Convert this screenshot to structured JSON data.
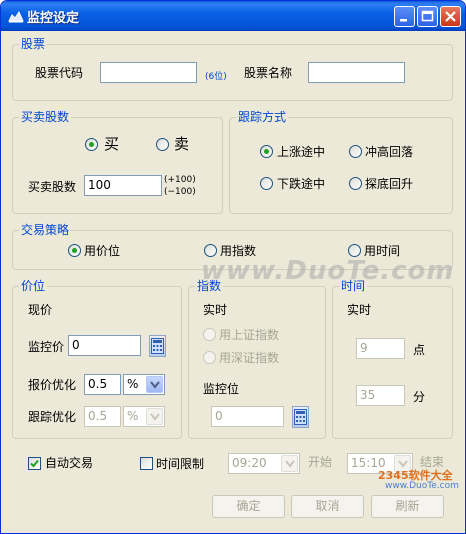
{
  "window": {
    "title": "监控设定"
  },
  "stock": {
    "group_title": "股票",
    "code_label": "股票代码",
    "code_value": "",
    "code_hint": "(6位)",
    "name_label": "股票名称",
    "name_value": ""
  },
  "trade": {
    "group_title": "买卖股数",
    "buy_label": "买",
    "sell_label": "卖",
    "selected": "buy",
    "qty_label": "买卖股数",
    "qty_value": "100",
    "step_up": "(+100)",
    "step_down": "(−100)"
  },
  "tracking": {
    "group_title": "跟踪方式",
    "options": [
      "上涨途中",
      "冲高回落",
      "下跌途中",
      "探底回升"
    ],
    "selected": "上涨途中"
  },
  "strategy": {
    "group_title": "交易策略",
    "options": [
      "用价位",
      "用指数",
      "用时间"
    ],
    "selected": "用价位"
  },
  "price": {
    "group_title": "价位",
    "current_label": "现价",
    "monitor_label": "监控价",
    "monitor_value": "0",
    "quote_opt_label": "报价优化",
    "quote_opt_value": "0.5",
    "quote_opt_unit": "%",
    "track_opt_label": "跟踪优化",
    "track_opt_value": "0.5",
    "track_opt_unit": "%"
  },
  "index": {
    "group_title": "指数",
    "realtime_label": "实时",
    "options": [
      "用上证指数",
      "用深证指数"
    ],
    "monitor_label": "监控位",
    "monitor_value": "0"
  },
  "time": {
    "group_title": "时间",
    "realtime_label": "实时",
    "hour_value": "9",
    "hour_label": "点",
    "minute_value": "35",
    "minute_label": "分"
  },
  "bottom": {
    "auto_trade_label": "自动交易",
    "auto_trade_checked": true,
    "time_limit_label": "时间限制",
    "time_limit_checked": false,
    "start_time": "09:20",
    "start_label": "开始",
    "end_time": "15:10",
    "end_label": "结束"
  },
  "buttons": {
    "ok": "确定",
    "cancel": "取消",
    "refresh": "刷新"
  },
  "watermark": {
    "text": "www.DuoTe.com",
    "site": "2345软件大全",
    "url": "www.DuoTe.com"
  },
  "colors": {
    "group_title": "#0046d5",
    "titlebar": "#0553d6",
    "radio_dot": "#21a121"
  }
}
